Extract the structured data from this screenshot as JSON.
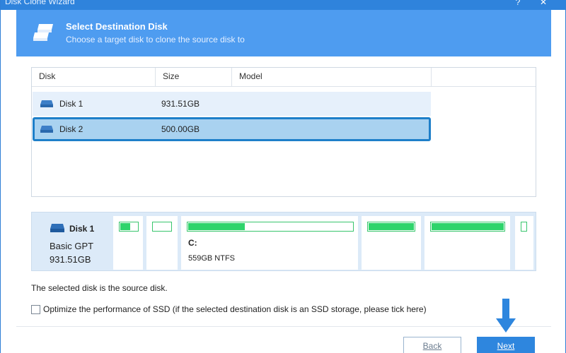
{
  "window": {
    "title": "Disk Clone Wizard"
  },
  "header": {
    "title": "Select Destination Disk",
    "subtitle": "Choose a target disk to clone the source disk to"
  },
  "table": {
    "columns": [
      "Disk",
      "Size",
      "Model"
    ],
    "rows": [
      {
        "disk": "Disk 1",
        "size": "931.51GB",
        "model": ""
      },
      {
        "disk": "Disk 2",
        "size": "500.00GB",
        "model": ""
      }
    ]
  },
  "disk_map": {
    "name": "Disk 1",
    "type": "Basic GPT",
    "size": "931.51GB",
    "partitions": [
      {
        "label": "",
        "desc": "",
        "used_fraction": 0.6
      },
      {
        "label": "",
        "desc": "",
        "used_fraction": 0.0
      },
      {
        "label": "C:",
        "desc": "559GB NTFS",
        "used_fraction": 0.35
      },
      {
        "label": "",
        "desc": "",
        "used_fraction": 1.0
      },
      {
        "label": "",
        "desc": "",
        "used_fraction": 1.0
      },
      {
        "label": "",
        "desc": "",
        "used_fraction": 0.0
      }
    ]
  },
  "status_text": "The selected disk is the source disk.",
  "optimize": {
    "label": "Optimize the performance of SSD (if the selected destination disk is an SSD storage, please tick here)",
    "checked": false
  },
  "buttons": {
    "back": "Back",
    "next": "Next"
  },
  "colors": {
    "accent": "#2e86de",
    "header": "#4e9cf0",
    "selected": "#a9d2f0",
    "partition": "#2ed46b"
  }
}
